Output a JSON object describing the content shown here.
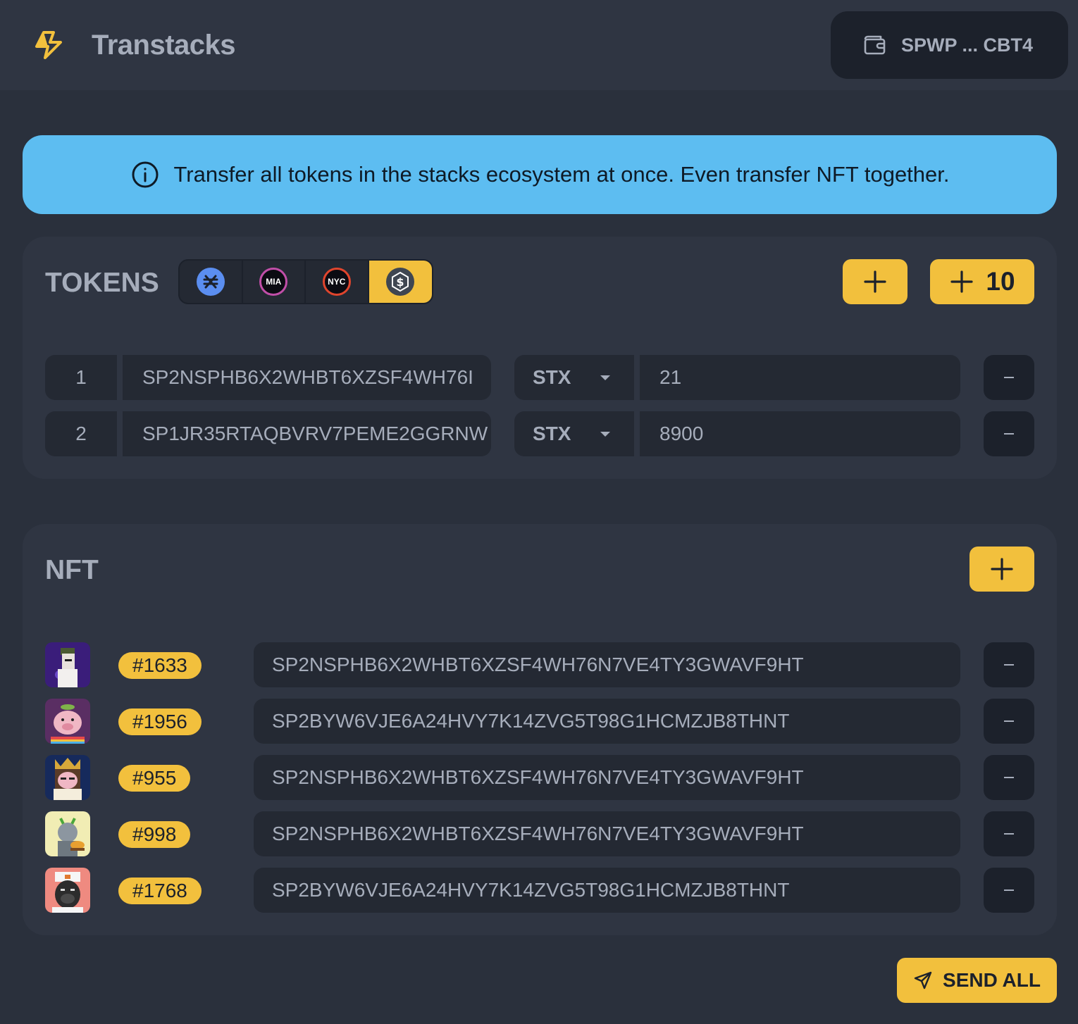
{
  "header": {
    "app_title": "Transtacks",
    "wallet_label": "SPWP ... CBT4",
    "logo_icon": "lightning-bolt-icon",
    "wallet_icon": "wallet-icon"
  },
  "banner": {
    "text": "Transfer all tokens in the stacks ecosystem at once. Even transfer NFT together.",
    "icon": "info-icon"
  },
  "tokens": {
    "title": "TOKENS",
    "tabs": [
      {
        "label": "",
        "icon": "stx-coin-icon",
        "color": "#5546ff"
      },
      {
        "label": "MIA",
        "icon": "mia-coin-icon",
        "color": "#000000"
      },
      {
        "label": "NYC",
        "icon": "nyc-coin-icon",
        "color": "#000000"
      },
      {
        "label": "",
        "icon": "usd-coin-icon",
        "color": "#3f4651",
        "active": true
      }
    ],
    "add_label": "",
    "add_ten_label": "10",
    "rows": [
      {
        "index": "1",
        "address": "SP2NSPHB6X2WHBT6XZSF4WH76I",
        "token": "STX",
        "amount": "21"
      },
      {
        "index": "2",
        "address": "SP1JR35RTAQBVRV7PEME2GGRNW",
        "token": "STX",
        "amount": "8900"
      }
    ]
  },
  "nft": {
    "title": "NFT",
    "rows": [
      {
        "id": "#1633",
        "address": "SP2NSPHB6X2WHBT6XZSF4WH76N7VE4TY3GWAVF9HT"
      },
      {
        "id": "#1956",
        "address": "SP2BYW6VJE6A24HVY7K14ZVG5T98G1HCMZJB8THNT"
      },
      {
        "id": "#955",
        "address": "SP2NSPHB6X2WHBT6XZSF4WH76N7VE4TY3GWAVF9HT"
      },
      {
        "id": "#998",
        "address": "SP2NSPHB6X2WHBT6XZSF4WH76N7VE4TY3GWAVF9HT"
      },
      {
        "id": "#1768",
        "address": "SP2BYW6VJE6A24HVY7K14ZVG5T98G1HCMZJB8THNT"
      }
    ]
  },
  "send_all_label": "SEND ALL",
  "colors": {
    "accent": "#f2c03d",
    "banner": "#5dbdf1",
    "background": "#2a303c",
    "card": "#2f3542"
  }
}
